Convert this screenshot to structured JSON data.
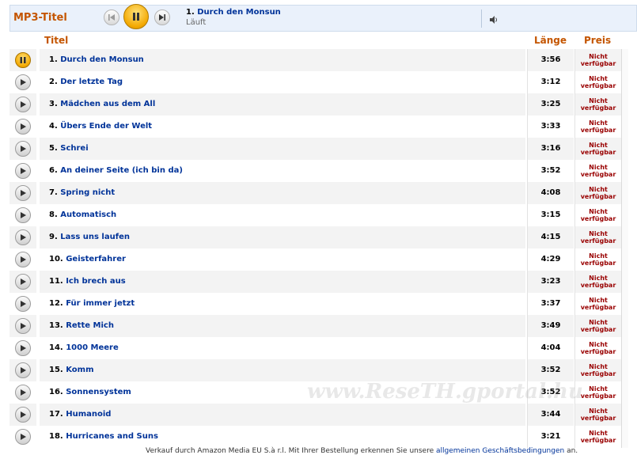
{
  "header": {
    "section_title": "MP3-Titel",
    "now_playing_number": "1.",
    "now_playing_title": "Durch den Monsun",
    "status": "Läuft"
  },
  "columns": {
    "title": "Titel",
    "length": "Länge",
    "price": "Preis"
  },
  "price_text": [
    "Nicht",
    "verfügbar"
  ],
  "tracks": [
    {
      "num": "1.",
      "title": "Durch den Monsun",
      "length": "3:56",
      "state": "playing"
    },
    {
      "num": "2.",
      "title": "Der letzte Tag",
      "length": "3:12",
      "state": "stopped"
    },
    {
      "num": "3.",
      "title": "Mädchen aus dem All",
      "length": "3:25",
      "state": "stopped"
    },
    {
      "num": "4.",
      "title": "Übers Ende der Welt",
      "length": "3:33",
      "state": "stopped"
    },
    {
      "num": "5.",
      "title": "Schrei",
      "length": "3:16",
      "state": "stopped"
    },
    {
      "num": "6.",
      "title": "An deiner Seite (ich bin da)",
      "length": "3:52",
      "state": "stopped"
    },
    {
      "num": "7.",
      "title": "Spring nicht",
      "length": "4:08",
      "state": "stopped"
    },
    {
      "num": "8.",
      "title": "Automatisch",
      "length": "3:15",
      "state": "stopped"
    },
    {
      "num": "9.",
      "title": "Lass uns laufen",
      "length": "4:15",
      "state": "stopped"
    },
    {
      "num": "10.",
      "title": "Geisterfahrer",
      "length": "4:29",
      "state": "stopped"
    },
    {
      "num": "11.",
      "title": "Ich brech aus",
      "length": "3:23",
      "state": "stopped"
    },
    {
      "num": "12.",
      "title": "Für immer jetzt",
      "length": "3:37",
      "state": "stopped"
    },
    {
      "num": "13.",
      "title": "Rette Mich",
      "length": "3:49",
      "state": "stopped"
    },
    {
      "num": "14.",
      "title": "1000 Meere",
      "length": "4:04",
      "state": "stopped"
    },
    {
      "num": "15.",
      "title": "Komm",
      "length": "3:52",
      "state": "stopped"
    },
    {
      "num": "16.",
      "title": "Sonnensystem",
      "length": "3:52",
      "state": "stopped"
    },
    {
      "num": "17.",
      "title": "Humanoid",
      "length": "3:44",
      "state": "stopped"
    },
    {
      "num": "18.",
      "title": "Hurricanes and Suns",
      "length": "3:21",
      "state": "stopped"
    }
  ],
  "watermark": "www.ReseTH.gportal.hu",
  "footer": {
    "text": "Verkauf durch Amazon Media EU S.à r.l. Mit Ihrer Bestellung erkennen Sie unsere ",
    "link": "allgemeinen Geschäftsbedingungen",
    "suffix": " an."
  },
  "colors": {
    "accent_orange": "#c45500",
    "link_blue": "#003399",
    "unavailable_red": "#990000",
    "player_bg": "#eaf1fb"
  },
  "icons": {
    "prev": "skip-previous-icon",
    "pause": "pause-icon",
    "next": "skip-next-icon",
    "volume": "speaker-icon",
    "play": "play-icon"
  }
}
